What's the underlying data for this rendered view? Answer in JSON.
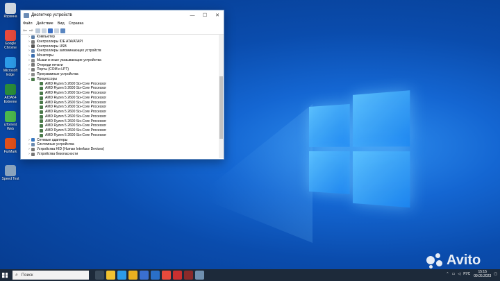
{
  "desktop": {
    "icons": [
      {
        "label": "Корзина",
        "color": "#d0d8e0"
      },
      {
        "label": "Google Chrome",
        "color": "#e84a3c"
      },
      {
        "label": "Microsoft Edge",
        "color": "#2c9be8"
      },
      {
        "label": "AIDA64 Extreme",
        "color": "#2a8c3a"
      },
      {
        "label": "uTorrent Web",
        "color": "#4cb84c"
      },
      {
        "label": "FurMark",
        "color": "#e0501a"
      },
      {
        "label": "Speed Test",
        "color": "#8aa3bd"
      }
    ]
  },
  "window": {
    "title": "Диспетчер устройств",
    "controls": {
      "minimize": "—",
      "maximize": "☐",
      "close": "✕"
    },
    "menu": [
      "Файл",
      "Действие",
      "Вид",
      "Справка"
    ],
    "tree": [
      {
        "label": "Компьютер",
        "expanded": false,
        "icon": "monitor-icon",
        "color": "#5d7fa8"
      },
      {
        "label": "Контроллеры IDE ATA/ATAPI",
        "expanded": false,
        "icon": "controller-icon",
        "color": "#7a7a7a"
      },
      {
        "label": "Контроллеры USB",
        "expanded": false,
        "icon": "usb-icon",
        "color": "#555555"
      },
      {
        "label": "Контроллеры запоминающих устройств",
        "expanded": false,
        "icon": "storage-icon",
        "color": "#6c8ab0"
      },
      {
        "label": "Мониторы",
        "expanded": false,
        "icon": "monitor-icon",
        "color": "#3d6fb0"
      },
      {
        "label": "Мыши и иные указывающие устройства",
        "expanded": false,
        "icon": "mouse-icon",
        "color": "#888888"
      },
      {
        "label": "Очереди печати",
        "expanded": false,
        "icon": "printer-icon",
        "color": "#777777"
      },
      {
        "label": "Порты (COM и LPT)",
        "expanded": false,
        "icon": "port-icon",
        "color": "#7a7a7a"
      },
      {
        "label": "Программные устройства",
        "expanded": false,
        "icon": "device-icon",
        "color": "#8a8a8a"
      },
      {
        "label": "Процессоры",
        "expanded": true,
        "icon": "cpu-icon",
        "color": "#4a7a4a"
      }
    ],
    "processors": [
      "AMD Ryzen 5 2600 Six-Core Processor",
      "AMD Ryzen 5 2600 Six-Core Processor",
      "AMD Ryzen 5 2600 Six-Core Processor",
      "AMD Ryzen 5 2600 Six-Core Processor",
      "AMD Ryzen 5 2600 Six-Core Processor",
      "AMD Ryzen 5 2600 Six-Core Processor",
      "AMD Ryzen 5 2600 Six-Core Processor",
      "AMD Ryzen 5 2600 Six-Core Processor",
      "AMD Ryzen 5 2600 Six-Core Processor",
      "AMD Ryzen 5 2600 Six-Core Processor",
      "AMD Ryzen 5 2600 Six-Core Processor",
      "AMD Ryzen 5 2600 Six-Core Processor"
    ],
    "tree_after": [
      {
        "label": "Сетевые адаптеры",
        "icon": "network-icon",
        "color": "#3a78c0"
      },
      {
        "label": "Системные устройства",
        "icon": "system-icon",
        "color": "#6a8ab0"
      },
      {
        "label": "Устройства HID (Human Interface Devices)",
        "icon": "hid-icon",
        "color": "#777777"
      },
      {
        "label": "Устройства безопасности",
        "icon": "security-icon",
        "color": "#777777"
      }
    ]
  },
  "taskbar": {
    "search_placeholder": "Поиск",
    "apps": [
      {
        "name": "task-view-icon",
        "color": "#3a4a5a"
      },
      {
        "name": "file-explorer-icon",
        "color": "#f2c230"
      },
      {
        "name": "edge-icon",
        "color": "#2c9be8"
      },
      {
        "name": "file-explorer-icon",
        "color": "#e8b020"
      },
      {
        "name": "store-icon",
        "color": "#3a6fd0"
      },
      {
        "name": "mail-icon",
        "color": "#2a70c8"
      },
      {
        "name": "chrome-icon",
        "color": "#e84a3c"
      },
      {
        "name": "app-icon",
        "color": "#c83030"
      },
      {
        "name": "app-icon",
        "color": "#8a2a2a"
      },
      {
        "name": "device-manager-icon",
        "color": "#7090b0"
      }
    ],
    "language": "РУС",
    "time": "15:15",
    "date": "09.05.2023"
  },
  "watermark": {
    "text": "Avito"
  }
}
